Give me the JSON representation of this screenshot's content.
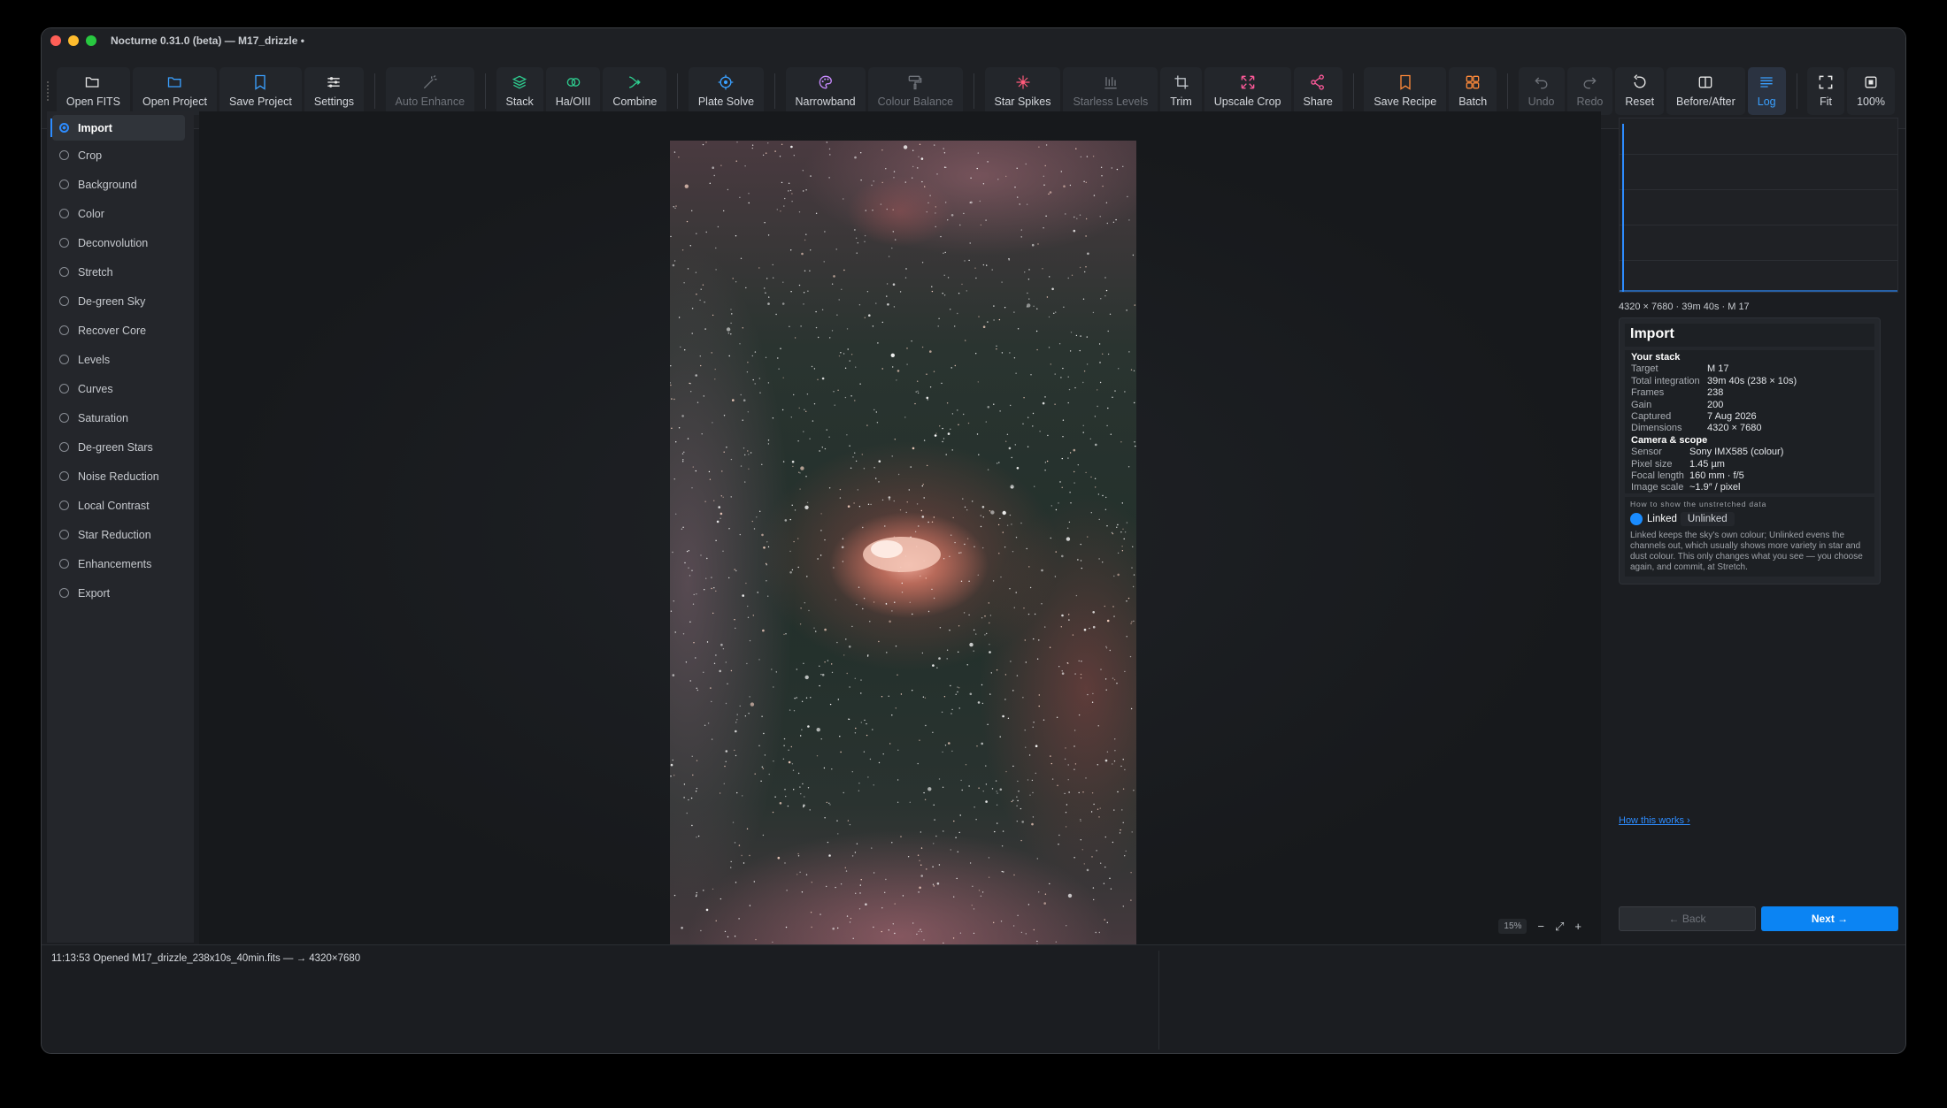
{
  "window": {
    "title": "Nocturne 0.31.0 (beta) — M17_drizzle •"
  },
  "toolbar": {
    "groups": [
      [
        {
          "label": "Open FITS",
          "icon": "folder-icon",
          "state": "normal",
          "color": "#e6e6e6"
        },
        {
          "label": "Open Project",
          "icon": "folder-icon",
          "state": "normal",
          "color": "#3aa0ff"
        },
        {
          "label": "Save Project",
          "icon": "bookmark-icon",
          "state": "normal",
          "color": "#3aa0ff"
        },
        {
          "label": "Settings",
          "icon": "sliders-icon",
          "state": "normal",
          "color": "#e6e6e6"
        }
      ],
      [
        {
          "label": "Auto Enhance",
          "icon": "wand-icon",
          "state": "disabled",
          "color": "#6f737a"
        }
      ],
      [
        {
          "label": "Stack",
          "icon": "layers-icon",
          "state": "normal",
          "color": "#2ecc8f"
        },
        {
          "label": "Ha/OIII",
          "icon": "rings-icon",
          "state": "normal",
          "color": "#2ecc8f"
        },
        {
          "label": "Combine",
          "icon": "merge-icon",
          "state": "normal",
          "color": "#2ecc8f"
        }
      ],
      [
        {
          "label": "Plate Solve",
          "icon": "target-icon",
          "state": "normal",
          "color": "#3aa0ff"
        }
      ],
      [
        {
          "label": "Narrowband",
          "icon": "palette-icon",
          "state": "normal",
          "color": "#c88bff"
        },
        {
          "label": "Colour Balance",
          "icon": "roller-icon",
          "state": "disabled",
          "color": "#6f737a"
        }
      ],
      [
        {
          "label": "Star Spikes",
          "icon": "star-icon",
          "state": "normal",
          "color": "#ff5a7a"
        },
        {
          "label": "Starless Levels",
          "icon": "bars-icon",
          "state": "disabled",
          "color": "#6f737a"
        },
        {
          "label": "Trim",
          "icon": "crop-icon",
          "state": "normal",
          "color": "#bfc3c9"
        },
        {
          "label": "Upscale Crop",
          "icon": "expand-icon",
          "state": "normal",
          "color": "#ff5a9a"
        },
        {
          "label": "Share",
          "icon": "share-icon",
          "state": "normal",
          "color": "#ff5a9a"
        }
      ],
      [
        {
          "label": "Save Recipe",
          "icon": "bookmark-icon",
          "state": "normal",
          "color": "#ff8a3a"
        },
        {
          "label": "Batch",
          "icon": "grid-icon",
          "state": "normal",
          "color": "#ff8a3a"
        }
      ],
      [
        {
          "label": "Undo",
          "icon": "undo-icon",
          "state": "disabled",
          "color": "#6f737a"
        },
        {
          "label": "Redo",
          "icon": "redo-icon",
          "state": "disabled",
          "color": "#6f737a"
        },
        {
          "label": "Reset",
          "icon": "reset-icon",
          "state": "normal",
          "color": "#e6e6e6"
        },
        {
          "label": "Before/After",
          "icon": "split-icon",
          "state": "normal",
          "color": "#e6e6e6"
        },
        {
          "label": "Log",
          "icon": "lines-icon",
          "state": "active",
          "color": "#3aa0ff"
        }
      ],
      [
        {
          "label": "Fit",
          "icon": "fit-icon",
          "state": "normal",
          "color": "#e6e6e6"
        },
        {
          "label": "100%",
          "icon": "square-icon",
          "state": "normal",
          "color": "#e6e6e6"
        }
      ]
    ]
  },
  "sidebar": {
    "items": [
      "Import",
      "Crop",
      "Background",
      "Color",
      "Deconvolution",
      "Stretch",
      "De-green Sky",
      "Recover Core",
      "Levels",
      "Curves",
      "Saturation",
      "De-green Stars",
      "Noise Reduction",
      "Local Contrast",
      "Star Reduction",
      "Enhancements",
      "Export"
    ],
    "active": "Import"
  },
  "canvas": {
    "zoom": "15%",
    "zoom_out": "−",
    "fit": "⤢",
    "zoom_in": "+"
  },
  "right": {
    "meta": "4320 × 7680  ·  39m 40s  ·  M 17",
    "panel_title": "Import",
    "stack": {
      "heading": "Your stack",
      "rows": [
        {
          "k": "Target",
          "v": "M 17"
        },
        {
          "k": "Total integration",
          "v": "39m 40s (238 × 10s)"
        },
        {
          "k": "Frames",
          "v": "238"
        },
        {
          "k": "Gain",
          "v": "200"
        },
        {
          "k": "Captured",
          "v": "7 Aug 2026"
        },
        {
          "k": "Dimensions",
          "v": "4320 × 7680"
        }
      ]
    },
    "camera": {
      "heading": "Camera & scope",
      "rows": [
        {
          "k": "Sensor",
          "v": "Sony IMX585 (colour)"
        },
        {
          "k": "Pixel size",
          "v": "1.45 µm"
        },
        {
          "k": "Focal length",
          "v": "160 mm · f/5"
        },
        {
          "k": "Image scale",
          "v": "~1.9″ / pixel"
        }
      ]
    },
    "unstretched": {
      "heading": "How to show the unstretched data",
      "linked": "Linked",
      "unlinked": "Unlinked",
      "selected": "Linked",
      "help": "Linked keeps the sky's own colour; Unlinked evens the channels out, which usually shows more variety in star and dust colour. This only changes what you see — you choose again, and commit, at Stretch."
    },
    "how_link": "How this works ›",
    "back": "← Back",
    "next": "Next →"
  },
  "log": {
    "line": "11:13:53  Opened M17_drizzle_238x10s_40min.fits  —  → 4320×7680"
  }
}
